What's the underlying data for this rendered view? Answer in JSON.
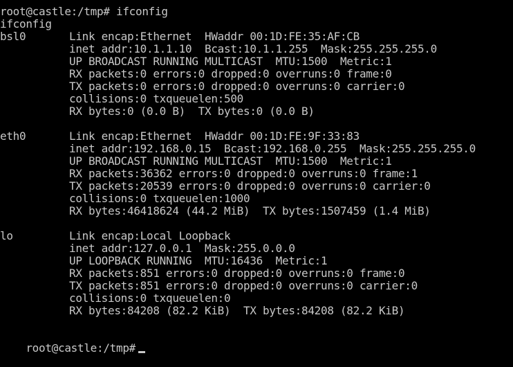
{
  "terminal": {
    "prompt_command": "root@castle:/tmp# ifconfig",
    "echo_command": "ifconfig",
    "final_prompt": "root@castle:/tmp#",
    "colors": {
      "background": "#000000",
      "text": "#c8c8c8"
    },
    "interfaces": [
      {
        "name": "bsl0",
        "lines": [
          "Link encap:Ethernet  HWaddr 00:1D:FE:35:AF:CB",
          "inet addr:10.1.1.10  Bcast:10.1.1.255  Mask:255.255.255.0",
          "UP BROADCAST RUNNING MULTICAST  MTU:1500  Metric:1",
          "RX packets:0 errors:0 dropped:0 overruns:0 frame:0",
          "TX packets:0 errors:0 dropped:0 overruns:0 carrier:0",
          "collisions:0 txqueuelen:500",
          "RX bytes:0 (0.0 B)  TX bytes:0 (0.0 B)"
        ]
      },
      {
        "name": "eth0",
        "lines": [
          "Link encap:Ethernet  HWaddr 00:1D:FE:9F:33:83",
          "inet addr:192.168.0.15  Bcast:192.168.0.255  Mask:255.255.255.0",
          "UP BROADCAST RUNNING MULTICAST  MTU:1500  Metric:1",
          "RX packets:36362 errors:0 dropped:0 overruns:0 frame:1",
          "TX packets:20539 errors:0 dropped:0 overruns:0 carrier:0",
          "collisions:0 txqueuelen:1000",
          "RX bytes:46418624 (44.2 MiB)  TX bytes:1507459 (1.4 MiB)"
        ]
      },
      {
        "name": "lo",
        "lines": [
          "Link encap:Local Loopback",
          "inet addr:127.0.0.1  Mask:255.0.0.0",
          "UP LOOPBACK RUNNING  MTU:16436  Metric:1",
          "RX packets:851 errors:0 dropped:0 overruns:0 frame:0",
          "TX packets:851 errors:0 dropped:0 overruns:0 carrier:0",
          "collisions:0 txqueuelen:0",
          "RX bytes:84208 (82.2 KiB)  TX bytes:84208 (82.2 KiB)"
        ]
      }
    ]
  }
}
